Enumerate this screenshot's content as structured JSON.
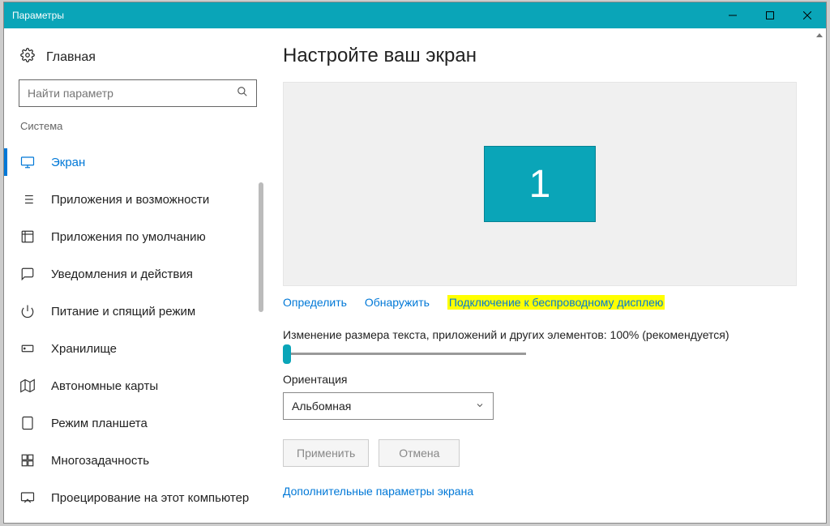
{
  "titlebar": {
    "title": "Параметры"
  },
  "sidebar": {
    "home": "Главная",
    "search_placeholder": "Найти параметр",
    "category": "Система",
    "items": [
      {
        "key": "display",
        "label": "Экран",
        "selected": true
      },
      {
        "key": "apps",
        "label": "Приложения и возможности"
      },
      {
        "key": "default-apps",
        "label": "Приложения по умолчанию"
      },
      {
        "key": "notifications",
        "label": "Уведомления и действия"
      },
      {
        "key": "power",
        "label": "Питание и спящий режим"
      },
      {
        "key": "storage",
        "label": "Хранилище"
      },
      {
        "key": "maps",
        "label": "Автономные карты"
      },
      {
        "key": "tablet",
        "label": "Режим планшета"
      },
      {
        "key": "multitask",
        "label": "Многозадачность"
      },
      {
        "key": "projecting",
        "label": "Проецирование на этот компьютер"
      }
    ]
  },
  "main": {
    "heading": "Настройте ваш экран",
    "monitor_number": "1",
    "links": {
      "identify": "Определить",
      "detect": "Обнаружить",
      "wireless": "Подключение к беспроводному дисплею"
    },
    "scale_label": "Изменение размера текста, приложений и других элементов: 100% (рекомендуется)",
    "orientation_label": "Ориентация",
    "orientation_value": "Альбомная",
    "apply": "Применить",
    "cancel": "Отмена",
    "advanced": "Дополнительные параметры экрана"
  },
  "colors": {
    "accent": "#0aa5b8",
    "link": "#0078d7"
  }
}
